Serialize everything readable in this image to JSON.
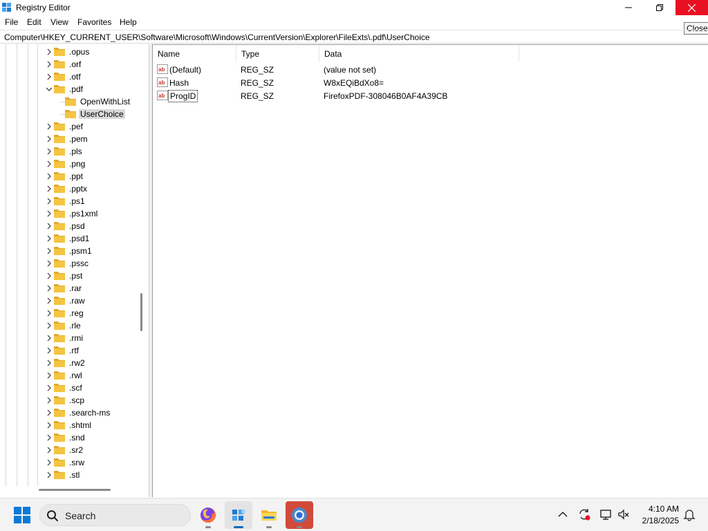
{
  "window": {
    "title": "Registry Editor",
    "close_tooltip": "Close"
  },
  "menu": [
    "File",
    "Edit",
    "View",
    "Favorites",
    "Help"
  ],
  "address": "Computer\\HKEY_CURRENT_USER\\Software\\Microsoft\\Windows\\CurrentVersion\\Explorer\\FileExts\\.pdf\\UserChoice",
  "tree": {
    "items": [
      {
        "label": ".opus",
        "expanded": false
      },
      {
        "label": ".orf",
        "expanded": false
      },
      {
        "label": ".otf",
        "expanded": false
      },
      {
        "label": ".pdf",
        "expanded": true
      },
      {
        "label": "OpenWithList",
        "child": true
      },
      {
        "label": "UserChoice",
        "child": true,
        "selected": true
      },
      {
        "label": ".pef",
        "expanded": false
      },
      {
        "label": ".pem",
        "expanded": false
      },
      {
        "label": ".pls",
        "expanded": false
      },
      {
        "label": ".png",
        "expanded": false
      },
      {
        "label": ".ppt",
        "expanded": false
      },
      {
        "label": ".pptx",
        "expanded": false
      },
      {
        "label": ".ps1",
        "expanded": false
      },
      {
        "label": ".ps1xml",
        "expanded": false
      },
      {
        "label": ".psd",
        "expanded": false
      },
      {
        "label": ".psd1",
        "expanded": false
      },
      {
        "label": ".psm1",
        "expanded": false
      },
      {
        "label": ".pssc",
        "expanded": false
      },
      {
        "label": ".pst",
        "expanded": false
      },
      {
        "label": ".rar",
        "expanded": false
      },
      {
        "label": ".raw",
        "expanded": false
      },
      {
        "label": ".reg",
        "expanded": false
      },
      {
        "label": ".rle",
        "expanded": false
      },
      {
        "label": ".rmi",
        "expanded": false
      },
      {
        "label": ".rtf",
        "expanded": false
      },
      {
        "label": ".rw2",
        "expanded": false
      },
      {
        "label": ".rwl",
        "expanded": false
      },
      {
        "label": ".scf",
        "expanded": false
      },
      {
        "label": ".scp",
        "expanded": false
      },
      {
        "label": ".search-ms",
        "expanded": false
      },
      {
        "label": ".shtml",
        "expanded": false
      },
      {
        "label": ".snd",
        "expanded": false
      },
      {
        "label": ".sr2",
        "expanded": false
      },
      {
        "label": ".srw",
        "expanded": false
      },
      {
        "label": ".stl",
        "expanded": false
      }
    ]
  },
  "list": {
    "columns": [
      "Name",
      "Type",
      "Data"
    ],
    "rows": [
      {
        "name": "(Default)",
        "type": "REG_SZ",
        "data": "(value not set)",
        "icon": "string-value-icon"
      },
      {
        "name": "Hash",
        "type": "REG_SZ",
        "data": "W8xEQiBdXo8=",
        "icon": "string-value-icon"
      },
      {
        "name": "ProgID",
        "type": "REG_SZ",
        "data": "FirefoxPDF-308046B0AF4A39CB",
        "icon": "string-value-icon",
        "focused": true
      }
    ]
  },
  "taskbar": {
    "search_label": "Search",
    "apps": [
      "firefox-icon",
      "registry-editor-icon",
      "file-explorer-icon",
      "chrome-icon"
    ],
    "time": "4:10 AM",
    "date": "2/18/2025"
  },
  "colors": {
    "close_button": "#e81123",
    "folder": "#f5c542",
    "accent": "#0067c0"
  }
}
